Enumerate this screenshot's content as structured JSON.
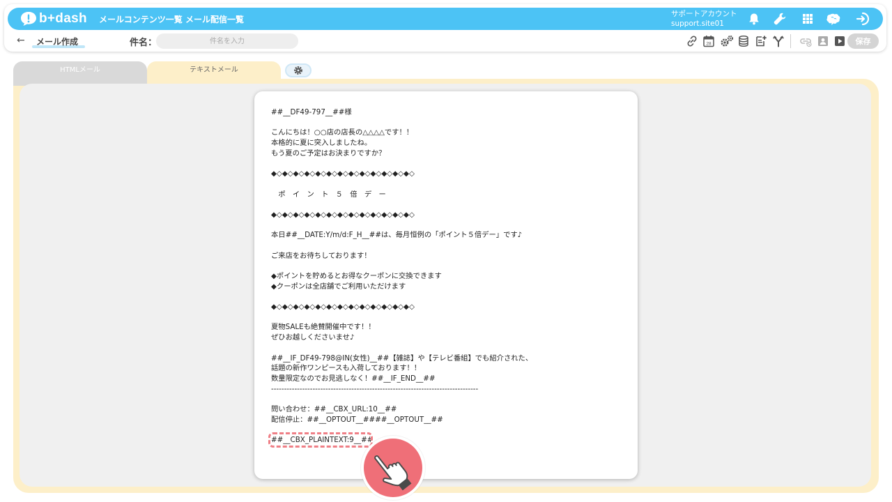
{
  "header": {
    "logo_text": "b+dash",
    "nav": [
      "メールコンテンツ一覧",
      "メール配信一覧"
    ],
    "account_name": "サポートアカウント",
    "account_id": "support.site01",
    "icons": [
      "bell-icon",
      "wrench-icon",
      "grid-icon",
      "brain-icon",
      "logout-icon"
    ]
  },
  "subheader": {
    "back_arrow": "←",
    "page_title": "メール作成",
    "subject_label": "件名：",
    "subject_placeholder": "件名を入力",
    "save_label": "保存",
    "tool_icons": [
      "link-icon",
      "calendar-icon",
      "gears-icon",
      "database-icon",
      "add-document-icon",
      "branch-icon",
      "link-disabled-icon",
      "person-card-icon",
      "play-icon"
    ],
    "calendar_day": "28"
  },
  "tabs": {
    "html_label": "HTMLメール",
    "text_label": "テキストメール"
  },
  "email_lines": [
    "##__DF49-797__##様",
    "",
    "こんにちは！○○店の店長の△△△△です！！",
    "本格的に夏に突入しましたね。",
    "もう夏のご予定はお決まりですか？",
    "",
    "◆◇◆◇◆◇◆◇◆◇◆◇◆◇◆◇◆◇◆◇◆◇◆◇◆◇",
    "",
    "　ポ　イ　ン　ト　５　倍　デ　ー",
    "",
    "◆◇◆◇◆◇◆◇◆◇◆◇◆◇◆◇◆◇◆◇◆◇◆◇◆◇",
    "",
    "本日##__DATE:Y/m/d:F_H__##は、毎月恒例の「ポイント５倍デー」です♪",
    "",
    "ご来店をお待ちしております！",
    "",
    "◆ポイントを貯めるとお得なクーポンに交換できます",
    "◆クーポンは全店舗でご利用いただけます",
    "",
    "◆◇◆◇◆◇◆◇◆◇◆◇◆◇◆◇◆◇◆◇◆◇◆◇◆◇",
    "",
    "夏物SALEも絶賛開催中です！！",
    "ぜひお越しくださいませ♪",
    "",
    "##__IF_DF49-798@IN(女性)__##【雑誌】や【テレビ番組】でも紹介された、",
    "話題の新作ワンピースも入荷しております！！",
    "数量限定なのでお見逃しなく！##__IF_END__##",
    "--------------------------------------------------------------------------------",
    "",
    "問い合わせ：##__CBX_URL:10__##",
    "配信停止：##__OPTOUT__####__OPTOUT__##",
    "",
    "##__CBX_PLAINTEXT:9__##"
  ],
  "colors": {
    "brand_blue": "#4cc3f5",
    "tab_yellow": "#fdefc9",
    "highlight_red": "#ef7f86"
  }
}
